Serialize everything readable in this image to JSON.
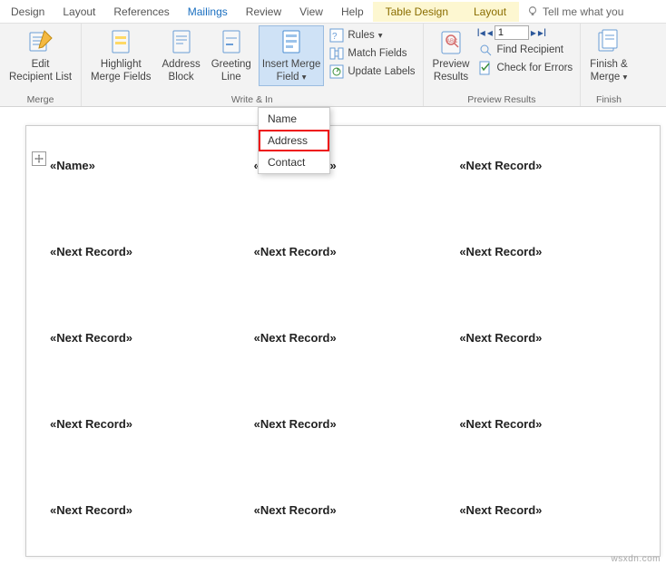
{
  "tabs": {
    "design": "Design",
    "layout": "Layout",
    "references": "References",
    "mailings": "Mailings",
    "review": "Review",
    "view": "View",
    "help": "Help",
    "table_design": "Table Design",
    "table_layout": "Layout",
    "tell_me": "Tell me what you"
  },
  "ribbon": {
    "merge_group": "Merge",
    "write_insert_group": "Write & In",
    "preview_group": "Preview Results",
    "finish_group": "Finish",
    "edit_recipient": "Edit Recipient List",
    "highlight_merge": "Highlight Merge Fields",
    "address_block": "Address Block",
    "greeting_line": "Greeting Line",
    "insert_merge_field": "Insert Merge Field",
    "rules": "Rules",
    "match_fields": "Match Fields",
    "update_labels": "Update Labels",
    "preview_results": "Preview Results",
    "record_num": "1",
    "find_recipient": "Find Recipient",
    "check_errors": "Check for Errors",
    "finish_merge": "Finish & Merge"
  },
  "dropdown": {
    "name": "Name",
    "address": "Address",
    "contact": "Contact"
  },
  "document": {
    "cells": [
      "«Name»",
      "«Next Record»",
      "«Next Record»",
      "«Next Record»",
      "«Next Record»",
      "«Next Record»",
      "«Next Record»",
      "«Next Record»",
      "«Next Record»",
      "«Next Record»",
      "«Next Record»",
      "«Next Record»",
      "«Next Record»",
      "«Next Record»",
      "«Next Record»"
    ]
  },
  "watermark": "wsxdn.com"
}
